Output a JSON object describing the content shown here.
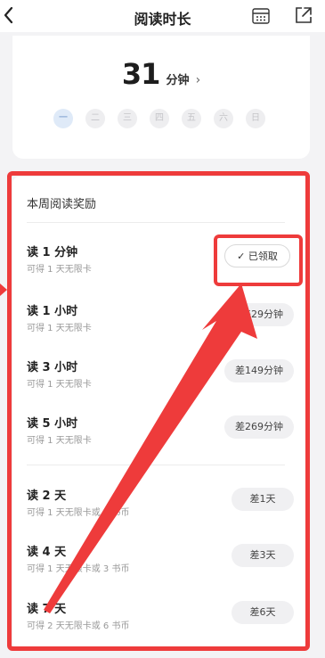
{
  "header": {
    "title": "阅读时长",
    "back_icon": "chevron-left-icon",
    "calendar_icon": "calendar-icon",
    "share_icon": "share-out-icon"
  },
  "stats": {
    "number": "31",
    "unit": "分钟",
    "chevron": "›",
    "days": [
      "一",
      "二",
      "三",
      "四",
      "五",
      "六",
      "日"
    ],
    "today_index": 0
  },
  "rewards": {
    "title": "本周阅读奖励",
    "items": [
      {
        "title": "读 1 分钟",
        "sub": "可得 1 天无限卡",
        "action": "已领取",
        "done": true
      },
      {
        "title": "读 1 小时",
        "sub": "可得 1 天无限卡",
        "action": "差29分钟",
        "done": false
      },
      {
        "title": "读 3 小时",
        "sub": "可得 1 天无限卡",
        "action": "差149分钟",
        "done": false
      },
      {
        "title": "读 5 小时",
        "sub": "可得 1 天无限卡",
        "action": "差269分钟",
        "done": false
      },
      {
        "title": "读 2 天",
        "sub": "可得 1 天无限卡或 1 书币",
        "action": "差1天",
        "done": false
      },
      {
        "title": "读 4 天",
        "sub": "可得 1 天无限卡或 3 书币",
        "action": "差3天",
        "done": false
      },
      {
        "title": "读 7 天",
        "sub": "可得 2 天无限卡或 6 书币",
        "action": "差6天",
        "done": false
      }
    ]
  },
  "colors": {
    "annotation": "#ee3b3b",
    "today_bg": "#dfeaf8"
  }
}
